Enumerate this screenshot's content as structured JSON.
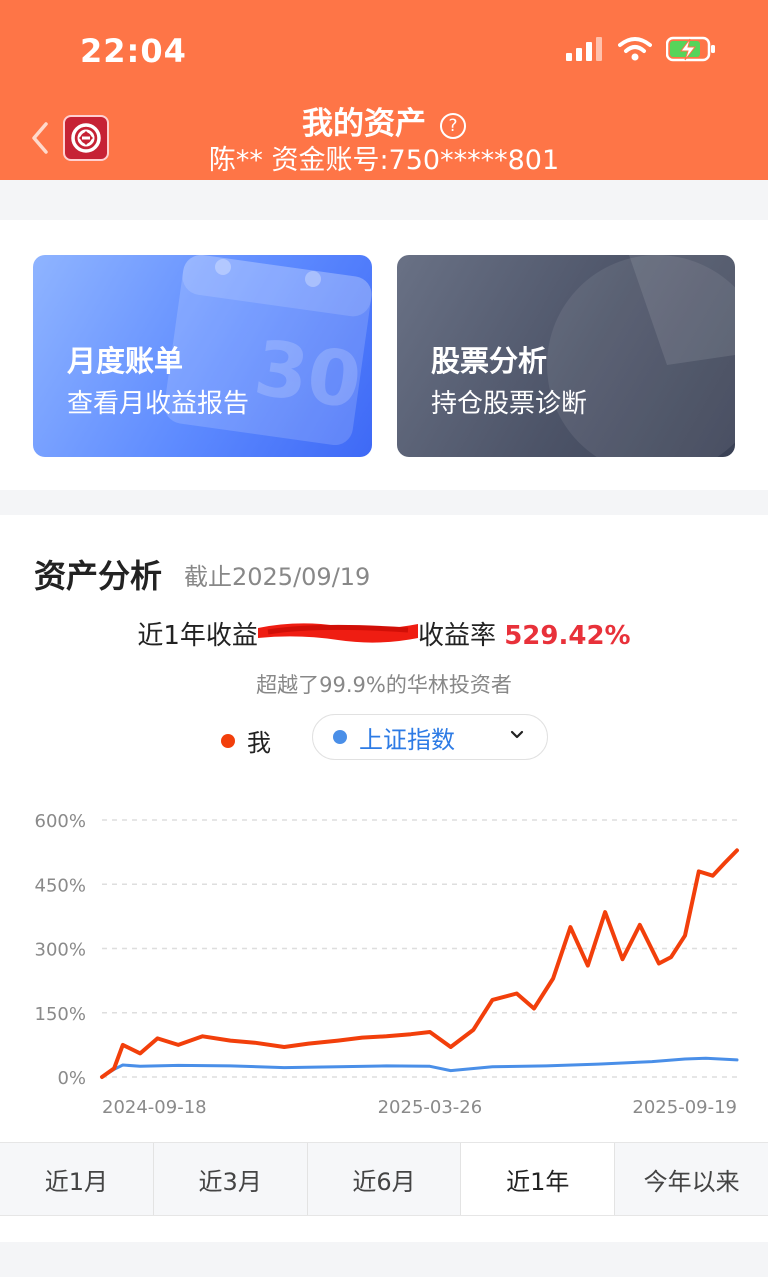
{
  "status_bar": {
    "time": "22:04"
  },
  "header": {
    "back_icon": "chevron-left-icon",
    "title": "我的资产",
    "help_icon": "?",
    "subtitle": "陈** 资金账号:750*****801",
    "brand_color": "#fe7547"
  },
  "cards": [
    {
      "title": "月度账单",
      "desc": "查看月收益报告"
    },
    {
      "title": "股票分析",
      "desc": "持仓股票诊断"
    }
  ],
  "asset": {
    "title": "资产分析",
    "date": "截止2025/09/19",
    "yield_label": "近1年收益",
    "rate_label": "收益率",
    "rate_value": "529.42%",
    "beat_text": "超越了99.9%的华林投资者",
    "legend_me": "我",
    "index_select": "上证指数"
  },
  "chart_data": {
    "type": "line",
    "x_ticks": [
      "2024-09-18",
      "2025-03-26",
      "2025-09-19"
    ],
    "y_ticks": [
      "600%",
      "450%",
      "300%",
      "150%",
      "0%"
    ],
    "ylim": [
      0,
      600
    ],
    "grid": true,
    "series": [
      {
        "name": "我",
        "color": "#f23f0b",
        "x": [
          "2024-09-18",
          "2024-09-25",
          "2024-09-30",
          "2024-10-10",
          "2024-10-20",
          "2024-11-01",
          "2024-11-15",
          "2024-12-01",
          "2024-12-15",
          "2025-01-01",
          "2025-01-15",
          "2025-02-01",
          "2025-02-15",
          "2025-03-01",
          "2025-03-15",
          "2025-03-26",
          "2025-04-07",
          "2025-04-20",
          "2025-05-01",
          "2025-05-15",
          "2025-05-25",
          "2025-06-05",
          "2025-06-15",
          "2025-06-25",
          "2025-07-05",
          "2025-07-15",
          "2025-07-25",
          "2025-08-05",
          "2025-08-12",
          "2025-08-20",
          "2025-08-28",
          "2025-09-05",
          "2025-09-12",
          "2025-09-19"
        ],
        "values": [
          0,
          20,
          75,
          55,
          90,
          75,
          95,
          85,
          80,
          70,
          78,
          85,
          92,
          95,
          100,
          105,
          70,
          110,
          180,
          195,
          160,
          230,
          350,
          260,
          385,
          275,
          355,
          265,
          280,
          330,
          480,
          470,
          500,
          529
        ]
      },
      {
        "name": "上证指数",
        "color": "#4a8fe8",
        "x": [
          "2024-09-18",
          "2024-09-25",
          "2024-09-30",
          "2024-10-10",
          "2024-11-01",
          "2024-12-01",
          "2025-01-01",
          "2025-02-01",
          "2025-03-01",
          "2025-03-26",
          "2025-04-07",
          "2025-05-01",
          "2025-06-01",
          "2025-07-01",
          "2025-08-01",
          "2025-08-20",
          "2025-09-01",
          "2025-09-19"
        ],
        "values": [
          0,
          18,
          28,
          25,
          27,
          26,
          22,
          24,
          26,
          25,
          15,
          24,
          26,
          30,
          36,
          42,
          44,
          40
        ]
      }
    ]
  },
  "tabs": [
    "近1月",
    "近3月",
    "近6月",
    "近1年",
    "今年以来"
  ],
  "active_tab": "近1年"
}
